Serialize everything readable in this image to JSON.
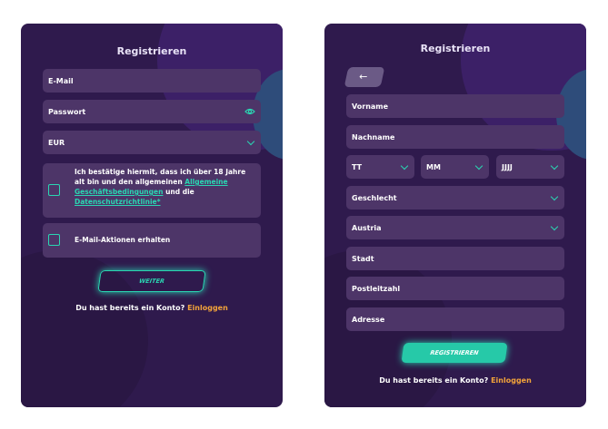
{
  "left": {
    "title": "Registrieren",
    "email": "E-Mail",
    "password": "Passwort",
    "currency": "EUR",
    "terms_pre": "Ich bestätige hiermit, dass ich über 18 Jahre alt bin und den allgemeinen ",
    "terms_link1": "Allgemeine Geschäftsbedingungen",
    "terms_mid": " und die ",
    "terms_link2": "Datenschutzrichtlinie*",
    "promo": "E-Mail-Aktionen erhalten",
    "next_button": "WEITER",
    "login_text": "Du hast bereits ein Konto?",
    "login_link": "Einloggen"
  },
  "right": {
    "title": "Registrieren",
    "back_icon": "arrow-left-icon",
    "first_name": "Vorname",
    "last_name": "Nachname",
    "day": "TT",
    "month": "MM",
    "year": "JJJJ",
    "gender": "Geschlecht",
    "country": "Austria",
    "city": "Stadt",
    "zip": "Postleitzahl",
    "address": "Adresse",
    "register_button": "REGISTRIEREN",
    "login_text": "Du hast bereits ein Konto?",
    "login_link": "Einloggen"
  },
  "colors": {
    "panel": "#2f1a4d",
    "field": "#4d3568",
    "accent": "#2ad6b2",
    "link_orange": "#f2a33a"
  }
}
